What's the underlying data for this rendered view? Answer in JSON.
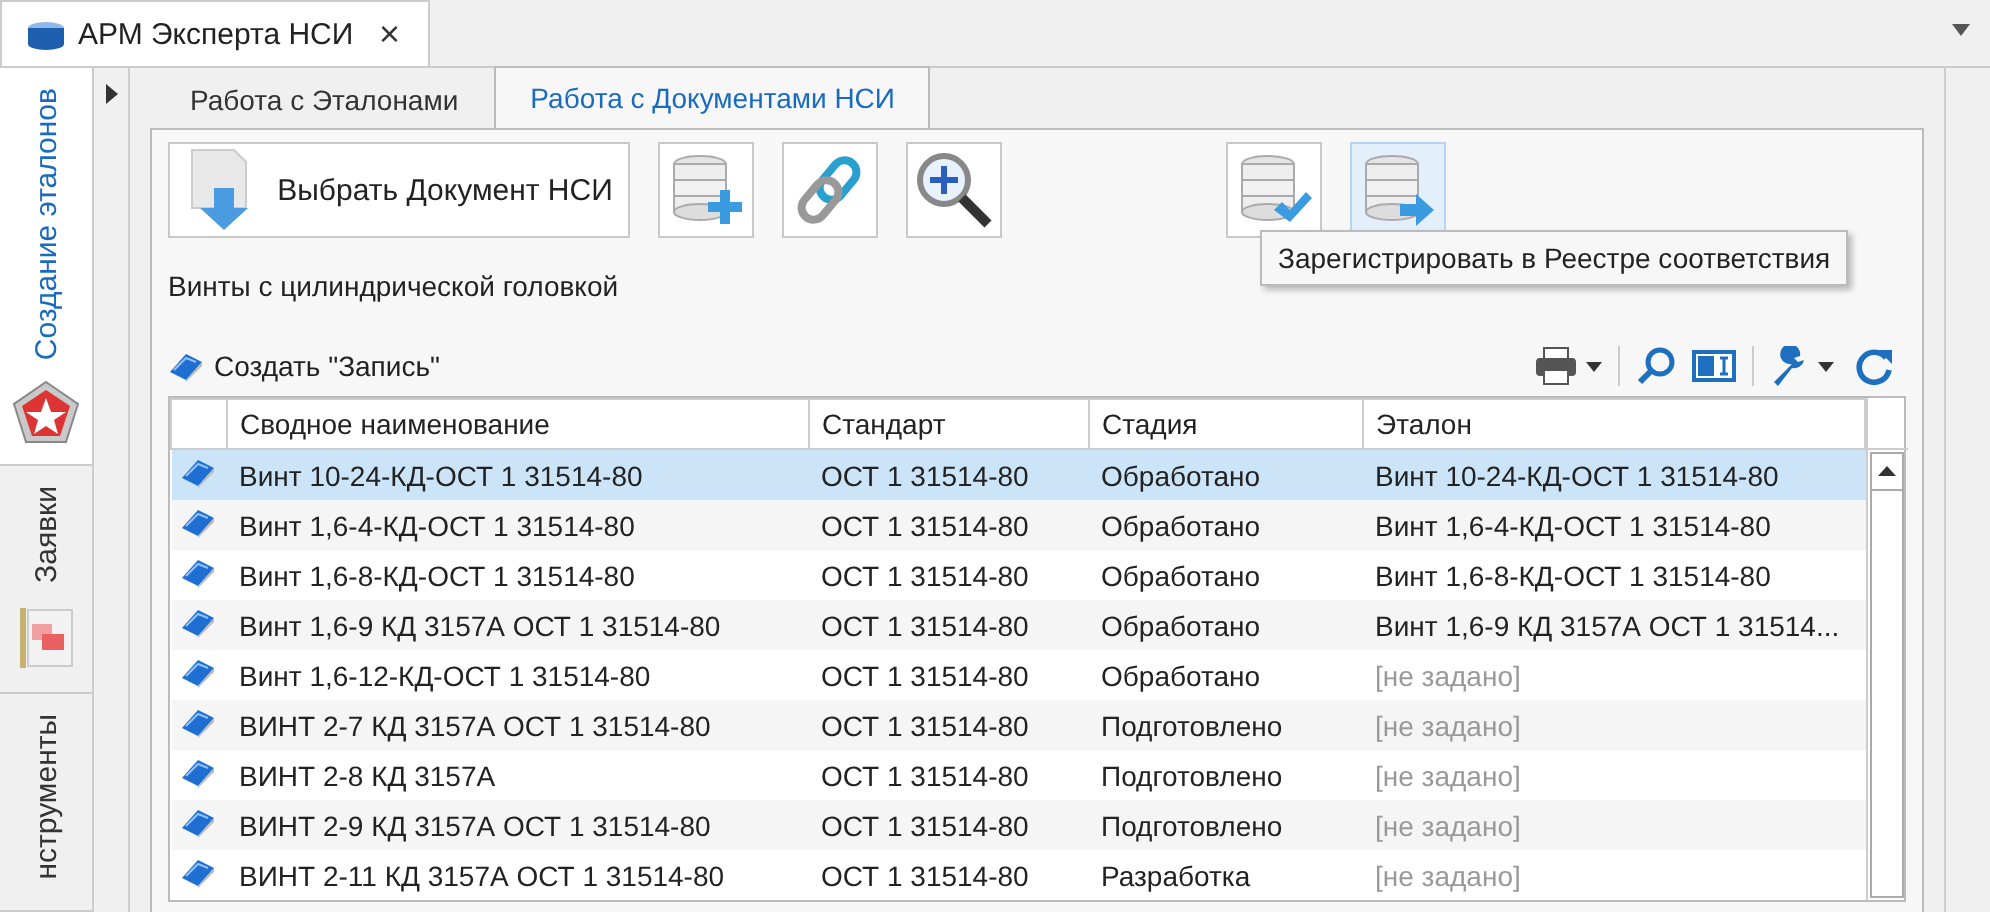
{
  "window": {
    "tab_title": "АРМ Эксперта НСИ",
    "close": "×"
  },
  "side_tabs": [
    {
      "label": "Создание эталонов",
      "selected": true
    },
    {
      "label": "Заявки",
      "selected": false
    },
    {
      "label": "нструменты",
      "selected": false
    }
  ],
  "tabs": [
    {
      "label": "Работа с Эталонами",
      "selected": false
    },
    {
      "label": "Работа с Документами НСИ",
      "selected": true
    }
  ],
  "toolbar": {
    "select_button": "Выбрать Документ НСИ",
    "tooltip": "Зарегистрировать в Реестре соответствия"
  },
  "document_title": "Винты с цилиндрической головкой",
  "create_button": "Создать \"Запись\"",
  "table": {
    "columns": [
      "Сводное наименование",
      "Стандарт",
      "Стадия",
      "Эталон"
    ],
    "rows": [
      {
        "name": "Винт 10-24-КД-ОСТ 1 31514-80",
        "standard": "ОСТ 1 31514-80",
        "stage": "Обработано",
        "etalon": "Винт 10-24-КД-ОСТ 1 31514-80",
        "etalon_unset": false,
        "selected": true
      },
      {
        "name": "Винт 1,6-4-КД-ОСТ 1 31514-80",
        "standard": "ОСТ 1 31514-80",
        "stage": "Обработано",
        "etalon": "Винт 1,6-4-КД-ОСТ 1 31514-80",
        "etalon_unset": false,
        "selected": false
      },
      {
        "name": "Винт 1,6-8-КД-ОСТ 1 31514-80",
        "standard": "ОСТ 1 31514-80",
        "stage": "Обработано",
        "etalon": "Винт 1,6-8-КД-ОСТ 1 31514-80",
        "etalon_unset": false,
        "selected": false
      },
      {
        "name": "Винт 1,6-9 КД 3157А ОСТ 1 31514-80",
        "standard": "ОСТ 1 31514-80",
        "stage": "Обработано",
        "etalon": "Винт 1,6-9 КД 3157А ОСТ 1 31514...",
        "etalon_unset": false,
        "selected": false
      },
      {
        "name": "Винт 1,6-12-КД-ОСТ 1 31514-80",
        "standard": "ОСТ 1 31514-80",
        "stage": "Обработано",
        "etalon": "[не задано]",
        "etalon_unset": true,
        "selected": false
      },
      {
        "name": "ВИНТ 2-7 КД 3157А ОСТ 1 31514-80",
        "standard": "ОСТ 1 31514-80",
        "stage": "Подготовлено",
        "etalon": "[не задано]",
        "etalon_unset": true,
        "selected": false
      },
      {
        "name": "ВИНТ 2-8 КД 3157А",
        "standard": "ОСТ 1 31514-80",
        "stage": "Подготовлено",
        "etalon": "[не задано]",
        "etalon_unset": true,
        "selected": false
      },
      {
        "name": "ВИНТ 2-9 КД 3157А ОСТ 1 31514-80",
        "standard": "ОСТ 1 31514-80",
        "stage": "Подготовлено",
        "etalon": "[не задано]",
        "etalon_unset": true,
        "selected": false
      },
      {
        "name": "ВИНТ 2-11 КД 3157А ОСТ 1 31514-80",
        "standard": "ОСТ 1 31514-80",
        "stage": "Разработка",
        "etalon": "[не задано]",
        "etalon_unset": true,
        "selected": false
      }
    ]
  }
}
